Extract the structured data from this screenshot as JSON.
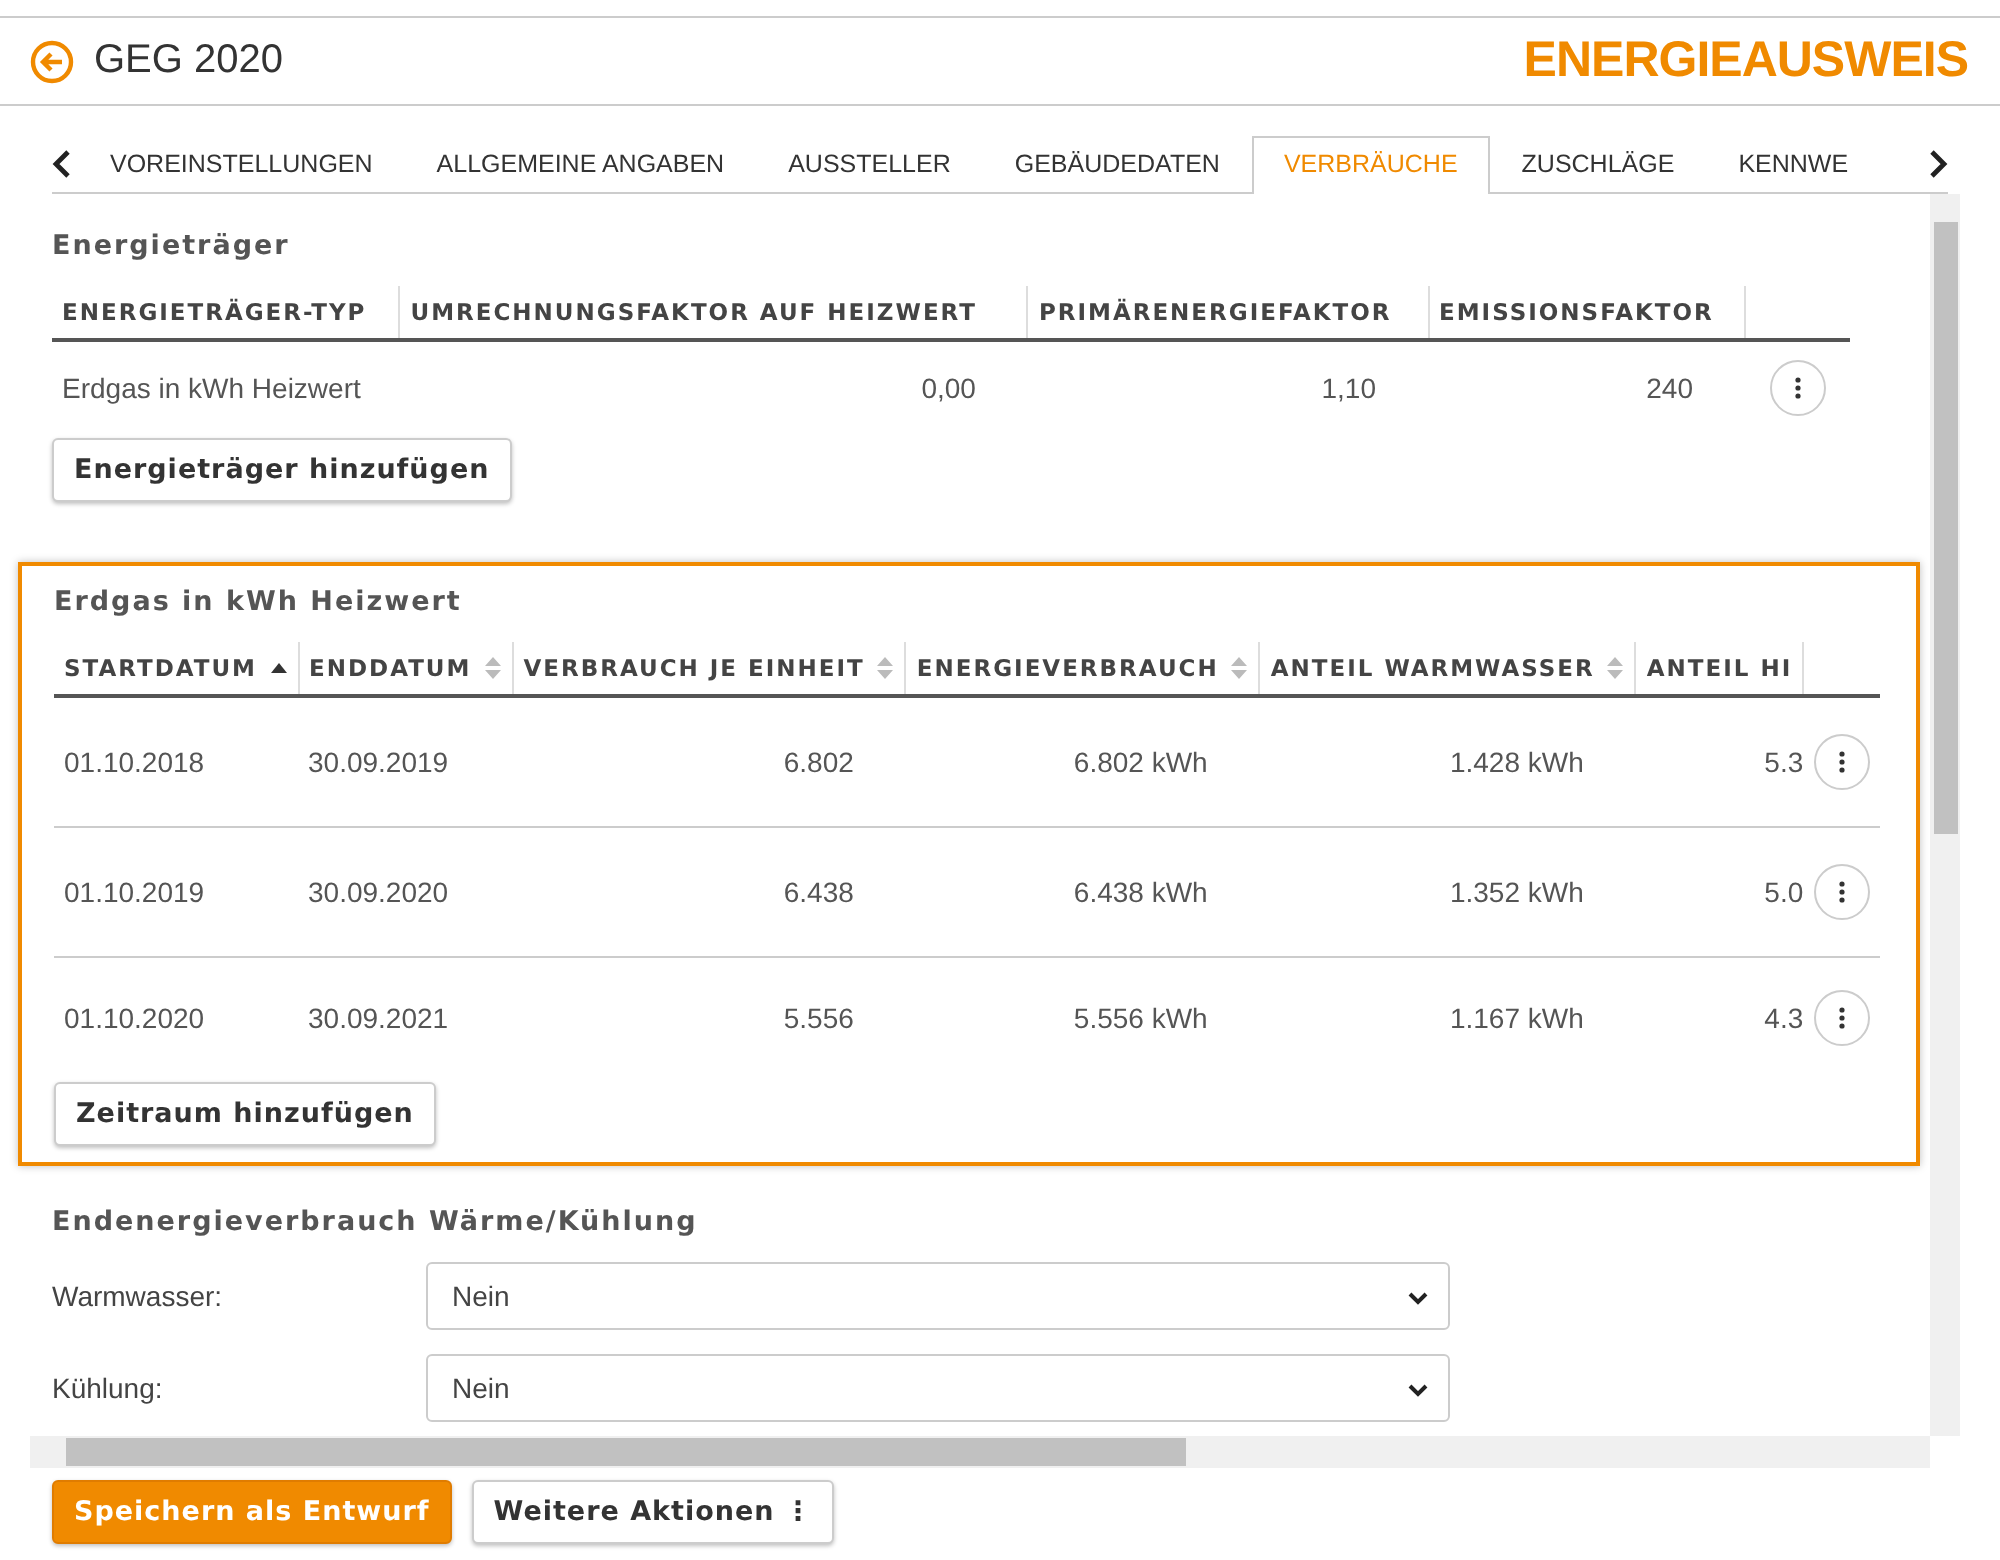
{
  "header": {
    "title": "GEG 2020",
    "brand": "ENERGIEAUSWEIS"
  },
  "tabs": [
    {
      "label": "VOREINSTELLUNGEN",
      "selected": false
    },
    {
      "label": "ALLGEMEINE ANGABEN",
      "selected": false
    },
    {
      "label": "AUSSTELLER",
      "selected": false
    },
    {
      "label": "GEBÄUDEDATEN",
      "selected": false
    },
    {
      "label": "VERBRÄUCHE",
      "selected": true
    },
    {
      "label": "ZUSCHLÄGE",
      "selected": false
    },
    {
      "label": "KENNWE",
      "selected": false
    }
  ],
  "energietraeger": {
    "title": "Energieträger",
    "columns": [
      "ENERGIETRÄGER-TYP",
      "UMRECHNUNGSFAKTOR AUF HEIZWERT",
      "PRIMÄRENERGIEFAKTOR",
      "EMISSIONSFAKTOR"
    ],
    "rows": [
      [
        "Erdgas in kWh Heizwert",
        "0,00",
        "1,10",
        "240"
      ]
    ],
    "add_button": "Energieträger hinzufügen"
  },
  "verbrauch": {
    "title": "Erdgas in kWh Heizwert",
    "highlighted": true,
    "columns": [
      {
        "label": "STARTDATUM",
        "sorted": true
      },
      {
        "label": "ENDDATUM",
        "sorted": false
      },
      {
        "label": "VERBRAUCH JE EINHEIT",
        "sorted": false
      },
      {
        "label": "ENERGIEVERBRAUCH",
        "sorted": false
      },
      {
        "label": "ANTEIL WARMWASSER",
        "sorted": false
      },
      {
        "label": "ANTEIL HI"
      }
    ],
    "rows": [
      [
        "01.10.2018",
        "30.09.2019",
        "6.802",
        "6.802 kWh",
        "1.428 kWh",
        "5.3"
      ],
      [
        "01.10.2019",
        "30.09.2020",
        "6.438",
        "6.438 kWh",
        "1.352 kWh",
        "5.0"
      ],
      [
        "01.10.2020",
        "30.09.2021",
        "5.556",
        "5.556 kWh",
        "1.167 kWh",
        "4.3"
      ]
    ],
    "add_button": "Zeitraum hinzufügen"
  },
  "endenergie": {
    "title": "Endenergieverbrauch Wärme/Kühlung",
    "fields": [
      {
        "label": "Warmwasser:",
        "value": "Nein"
      },
      {
        "label": "Kühlung:",
        "value": "Nein"
      }
    ]
  },
  "footer": {
    "save_button": "Speichern als Entwurf",
    "more_button": "Weitere Aktionen",
    "more_icon": "⋮"
  }
}
